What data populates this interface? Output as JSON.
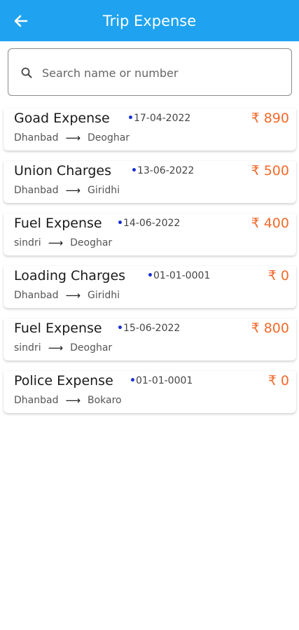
{
  "app_bar": {
    "title": "Trip Expense",
    "back_icon": "arrow-left-icon",
    "color": "#1fa3f0"
  },
  "search": {
    "placeholder": "Search name or number",
    "value": "",
    "icon": "search-icon"
  },
  "expenses": [
    {
      "title": "Goad Expense",
      "date": "17-04-2022",
      "amount": "₹ 890",
      "from": "Dhanbad",
      "to": "Deoghar"
    },
    {
      "title": "Union Charges",
      "date": "13-06-2022",
      "amount": "₹ 500",
      "from": "Dhanbad",
      "to": "Giridhi"
    },
    {
      "title": "Fuel Expense",
      "date": "14-06-2022",
      "amount": "₹ 400",
      "from": "sindri",
      "to": "Deoghar"
    },
    {
      "title": "Loading Charges",
      "date": "01-01-0001",
      "amount": "₹ 0",
      "from": "Dhanbad",
      "to": "Giridhi"
    },
    {
      "title": "Fuel Expense",
      "date": "15-06-2022",
      "amount": "₹ 800",
      "from": "sindri",
      "to": "Deoghar"
    },
    {
      "title": "Police Expense",
      "date": "01-01-0001",
      "amount": "₹ 0",
      "from": "Dhanbad",
      "to": "Bokaro"
    }
  ],
  "colors": {
    "amount": "#f26a2a",
    "date_dot": "#1a2fd8"
  }
}
